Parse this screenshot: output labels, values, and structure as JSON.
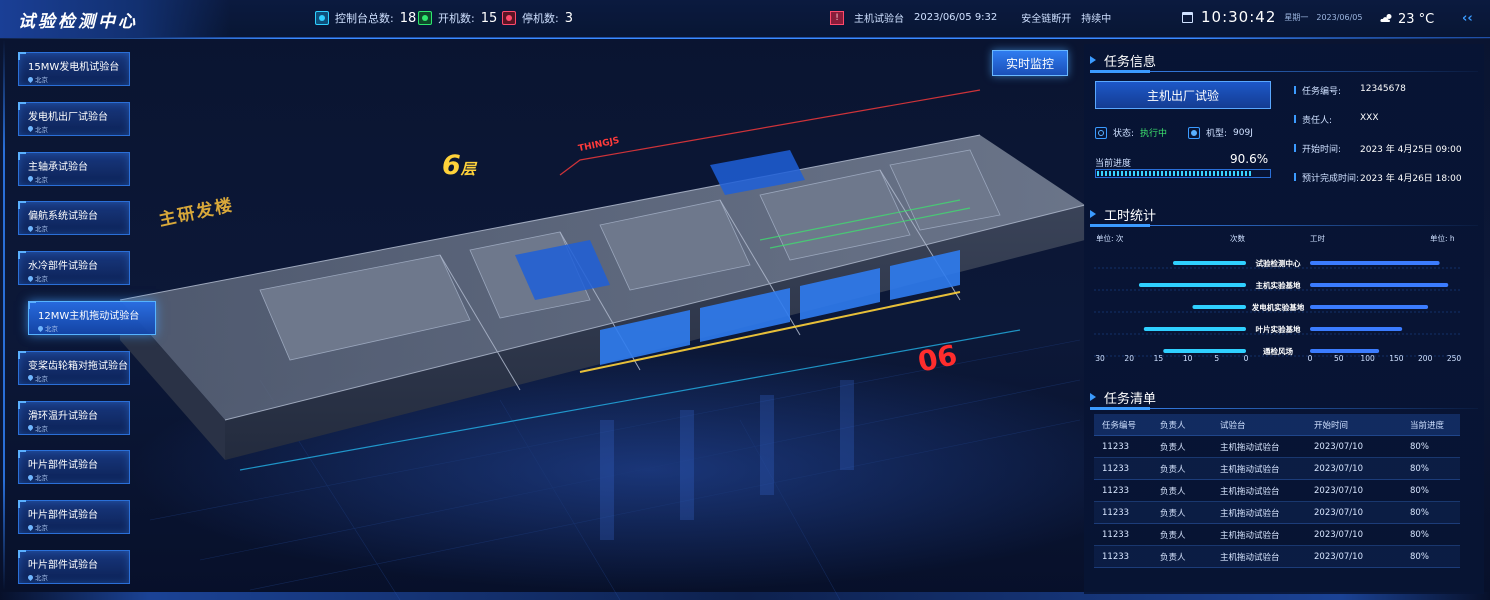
{
  "header": {
    "title": "试验检测中心",
    "stats": [
      {
        "label": "控制台总数:",
        "value": "18",
        "color": "#2fd0ff"
      },
      {
        "label": "开机数:",
        "value": "15",
        "color": "#2ee86e"
      },
      {
        "label": "停机数:",
        "value": "3",
        "color": "#ff4a6c"
      }
    ],
    "alarm": {
      "bench": "主机试验台",
      "datetime": "2023/06/05  9:32",
      "message": "安全链断开",
      "status": "持续中"
    },
    "time": "10:30:42",
    "weekday": "星期一",
    "date": "2023/06/05",
    "temperature": "23 °C"
  },
  "benches": [
    {
      "name": "15MW发电机试验台",
      "location": "北京",
      "active": false
    },
    {
      "name": "发电机出厂试验台",
      "location": "北京",
      "active": false
    },
    {
      "name": "主轴承试验台",
      "location": "北京",
      "active": false
    },
    {
      "name": "偏航系统试验台",
      "location": "北京",
      "active": false
    },
    {
      "name": "水冷部件试验台",
      "location": "北京",
      "active": false
    },
    {
      "name": "12MW主机拖动试验台",
      "location": "北京",
      "active": true
    },
    {
      "name": "变桨齿轮箱对拖试验台",
      "location": "北京",
      "active": false
    },
    {
      "name": "滑环温升试验台",
      "location": "北京",
      "active": false
    },
    {
      "name": "叶片部件试验台",
      "location": "北京",
      "active": false
    },
    {
      "name": "叶片部件试验台",
      "location": "北京",
      "active": false
    },
    {
      "name": "叶片部件试验台",
      "location": "北京",
      "active": false
    }
  ],
  "scene": {
    "floor_label": "6",
    "floor_suffix": "层",
    "building": "主研发楼",
    "watermark": "THINGJS",
    "floor_number": "06",
    "monitor_button": "实时监控"
  },
  "task_info": {
    "title": "任务信息",
    "task_name": "主机出厂试验",
    "status_label": "状态:",
    "status_value": "执行中",
    "model_label": "机型:",
    "model_value": "909J",
    "progress_label": "当前进度",
    "progress_value": "90.6%",
    "progress_fraction": 0.906,
    "fields": [
      {
        "key": "任务编号:",
        "value": "12345678"
      },
      {
        "key": "责任人:",
        "value": "XXX"
      },
      {
        "key": "开始时间:",
        "value": "2023 年 4月25日 09:00"
      },
      {
        "key": "预计完成时间:",
        "value": "2023 年 4月26日 18:00"
      }
    ]
  },
  "hours_stats": {
    "title": "工时统计",
    "unit_left": "单位: 次",
    "unit_right": "单位: h",
    "left_series": "次数",
    "right_series": "工时"
  },
  "chart_data": {
    "type": "bar",
    "categories": [
      "试验检测中心",
      "主机实验基地",
      "发电机实验基地",
      "叶片实验基地",
      "通检风场"
    ],
    "series": [
      {
        "name": "次数",
        "values": [
          15,
          22,
          11,
          21,
          17
        ]
      },
      {
        "name": "工时",
        "values": [
          225,
          240,
          205,
          160,
          120
        ]
      }
    ],
    "left_axis": {
      "ticks": [
        "30",
        "20",
        "15",
        "10",
        "5",
        "0"
      ],
      "range": [
        0,
        30
      ]
    },
    "right_axis": {
      "ticks": [
        "0",
        "50",
        "100",
        "150",
        "200",
        "250"
      ],
      "range": [
        0,
        250
      ]
    },
    "left_color": "#2fd0ff",
    "right_color": "#3b7cff"
  },
  "task_list": {
    "title": "任务清单",
    "columns": [
      "任务编号",
      "负责人",
      "试验台",
      "开始时间",
      "当前进度"
    ],
    "rows": [
      [
        "11233",
        "负责人",
        "主机拖动试验台",
        "2023/07/10",
        "80%"
      ],
      [
        "11233",
        "负责人",
        "主机拖动试验台",
        "2023/07/10",
        "80%"
      ],
      [
        "11233",
        "负责人",
        "主机拖动试验台",
        "2023/07/10",
        "80%"
      ],
      [
        "11233",
        "负责人",
        "主机拖动试验台",
        "2023/07/10",
        "80%"
      ],
      [
        "11233",
        "负责人",
        "主机拖动试验台",
        "2023/07/10",
        "80%"
      ],
      [
        "11233",
        "负责人",
        "主机拖动试验台",
        "2023/07/10",
        "80%"
      ]
    ]
  }
}
